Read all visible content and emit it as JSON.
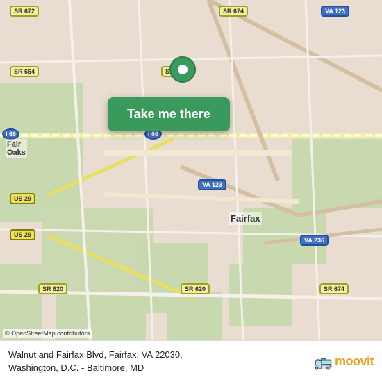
{
  "map": {
    "background_color": "#e8e0d8",
    "center_lat": 38.847,
    "center_lng": -77.317
  },
  "cta": {
    "label": "Take me there",
    "bg_color": "#3a9a5c"
  },
  "attribution": {
    "text": "© OpenStreetMap contributors"
  },
  "bottom_bar": {
    "location_line1": "Walnut and Fairfax Blvd, Fairfax, VA 22030,",
    "location_line2": "Washington, D.C. - Baltimore, MD",
    "logo_text": "moovit",
    "logo_icon": "🚌"
  },
  "badges": [
    {
      "id": "sr672",
      "label": "SR 672",
      "type": "sr"
    },
    {
      "id": "sr674",
      "label": "SR 674",
      "type": "sr"
    },
    {
      "id": "va123_top",
      "label": "VA 123",
      "type": "va"
    },
    {
      "id": "sr664",
      "label": "SR 664",
      "type": "sr"
    },
    {
      "id": "sr655",
      "label": "SR 655",
      "type": "sr"
    },
    {
      "id": "i66_left",
      "label": "I 66",
      "type": "i66"
    },
    {
      "id": "i66_center",
      "label": "I 66",
      "type": "i66"
    },
    {
      "id": "us29_top",
      "label": "US 29",
      "type": "us"
    },
    {
      "id": "us29_bottom",
      "label": "US 29",
      "type": "us"
    },
    {
      "id": "va123_mid",
      "label": "VA 123",
      "type": "va"
    },
    {
      "id": "fairfax_label",
      "label": "Fairfax",
      "type": "label"
    },
    {
      "id": "fairoaks_label",
      "label": "Fair\nOaks",
      "type": "label"
    },
    {
      "id": "va236",
      "label": "VA 236",
      "type": "va"
    },
    {
      "id": "sr620_left",
      "label": "SR 620",
      "type": "sr"
    },
    {
      "id": "sr620_right",
      "label": "SR 620",
      "type": "sr"
    }
  ]
}
